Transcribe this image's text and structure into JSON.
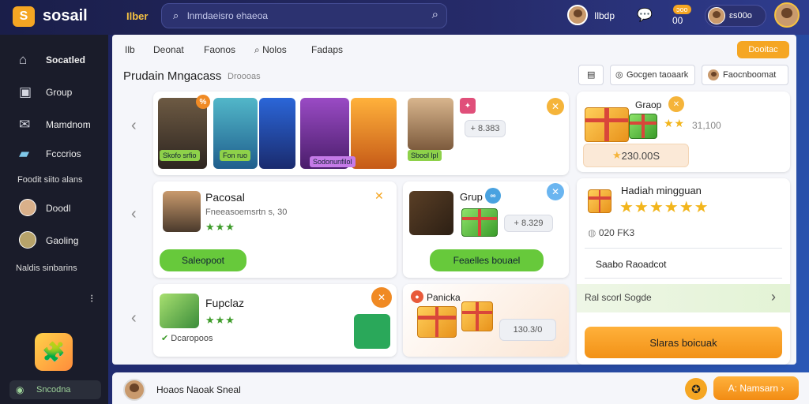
{
  "app": {
    "logo_letter": "S",
    "name": "sosail",
    "nav_link": "Ilber"
  },
  "search": {
    "icon": "search-icon",
    "placeholder": "lnmdaeisro ehaeoa"
  },
  "topbar": {
    "user_name": "Ilbdp",
    "notif_count": "00",
    "notif_badge": "ɔoo",
    "coins": "ɛs00o"
  },
  "sidebar": {
    "items": [
      {
        "icon": "home-icon",
        "label": "Socatled"
      },
      {
        "icon": "group-icon",
        "label": "Group"
      },
      {
        "icon": "mail-icon",
        "label": "Mamdnom"
      },
      {
        "icon": "folder-icon",
        "label": "Fcccrios"
      }
    ],
    "section_label": "Foodit siito alans",
    "friends": [
      {
        "label": "Doodl"
      },
      {
        "label": "Gaoling"
      }
    ],
    "section_label_2": "Naldis sinbarins",
    "more": "⁝",
    "bottom_label": "Sncodna"
  },
  "main": {
    "tabs": [
      "Ilb",
      "Deonat",
      "Faonos",
      "Nolos",
      "Fadaps"
    ],
    "top_button": "Dooitac",
    "section_title": "Prudain Mngacass",
    "section_sub": "Droooas",
    "filter_1": "",
    "filter_2": "Gocgen taoaark",
    "filter_3": "Faocnboomat",
    "featured_labels": [
      "Skofo srfio",
      "Fon ruo",
      "Sodonunfilol",
      "Sbool lpl"
    ],
    "featured_price": "+ 8.383",
    "recommend": {
      "name": "Pacosal",
      "desc": "Fneeasoemsrtn s, 30",
      "stars": "★★★",
      "button": "Saleopoot"
    },
    "group_card": {
      "name": "Grup",
      "price": "+ 8.329",
      "button": "Feaelles bouael"
    },
    "small_card": {
      "name": "Fupclaz",
      "stars": "★★★",
      "status": "Dcaropoos"
    },
    "gift_card": {
      "name": "Panicka",
      "price": "130.3/0"
    }
  },
  "right_panel": {
    "group_title": "Graop",
    "group_stars": "★★",
    "group_value": "31,100",
    "group_total": "230.00S",
    "hadiah_title": "Hadiah mingguan",
    "hadiah_stars": "★★★★★★",
    "coin_value": "020 FK3",
    "sub_title": "Saabo Raoadcot",
    "link": "Ral scorl Sogde",
    "cta": "Slaras boicuak"
  },
  "bottom": {
    "user_label": "Hoaos Naoak Sneal",
    "round_icon": "✪",
    "cta": "A: Namsarn  ›"
  }
}
